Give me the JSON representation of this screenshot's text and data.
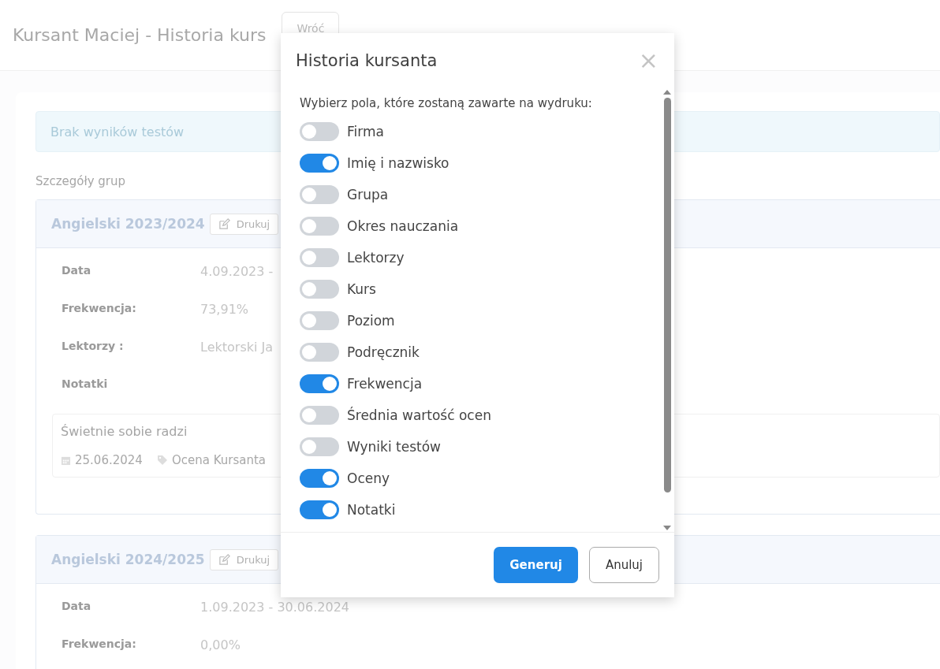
{
  "page": {
    "title": "Kursant Maciej - Historia kurs",
    "back_button": "Wróć"
  },
  "alert": "Brak wyników testów",
  "section_title": "Szczegóły grup",
  "groups": [
    {
      "name": "Angielski 2023/2024",
      "print_button": "Drukuj",
      "details": [
        {
          "label": "Data",
          "value": "4.09.2023 -"
        },
        {
          "label": "Frekwencja:",
          "value": "73,91%"
        },
        {
          "label": "Lektorzy :",
          "value": "Lektorski Ja"
        },
        {
          "label": "Notatki"
        }
      ],
      "notes": [
        {
          "text": "Świetnie sobie radzi",
          "date": "25.06.2024",
          "tag": "Ocena Kursanta"
        }
      ]
    },
    {
      "name": "Angielski 2024/2025",
      "print_button": "Drukuj",
      "details": [
        {
          "label": "Data",
          "value": "1.09.2023 - 30.06.2024"
        },
        {
          "label": "Frekwencja:",
          "value": "0,00%"
        }
      ]
    }
  ],
  "modal": {
    "title": "Historia kursanta",
    "close": "×",
    "prompt": "Wybierz pola, które zostaną zawarte na wydruku:",
    "fields": [
      {
        "label": "Firma",
        "on": false
      },
      {
        "label": "Imię i nazwisko",
        "on": true
      },
      {
        "label": "Grupa",
        "on": false
      },
      {
        "label": "Okres nauczania",
        "on": false
      },
      {
        "label": "Lektorzy",
        "on": false
      },
      {
        "label": "Kurs",
        "on": false
      },
      {
        "label": "Poziom",
        "on": false
      },
      {
        "label": "Podręcznik",
        "on": false
      },
      {
        "label": "Frekwencja",
        "on": true
      },
      {
        "label": "Średnia wartość ocen",
        "on": false
      },
      {
        "label": "Wyniki testów",
        "on": false
      },
      {
        "label": "Oceny",
        "on": true
      },
      {
        "label": "Notatki",
        "on": true
      }
    ],
    "buttons": [
      {
        "label": "Generuj",
        "kind": "primary"
      },
      {
        "label": "Anuluj",
        "kind": "secondary"
      }
    ]
  }
}
